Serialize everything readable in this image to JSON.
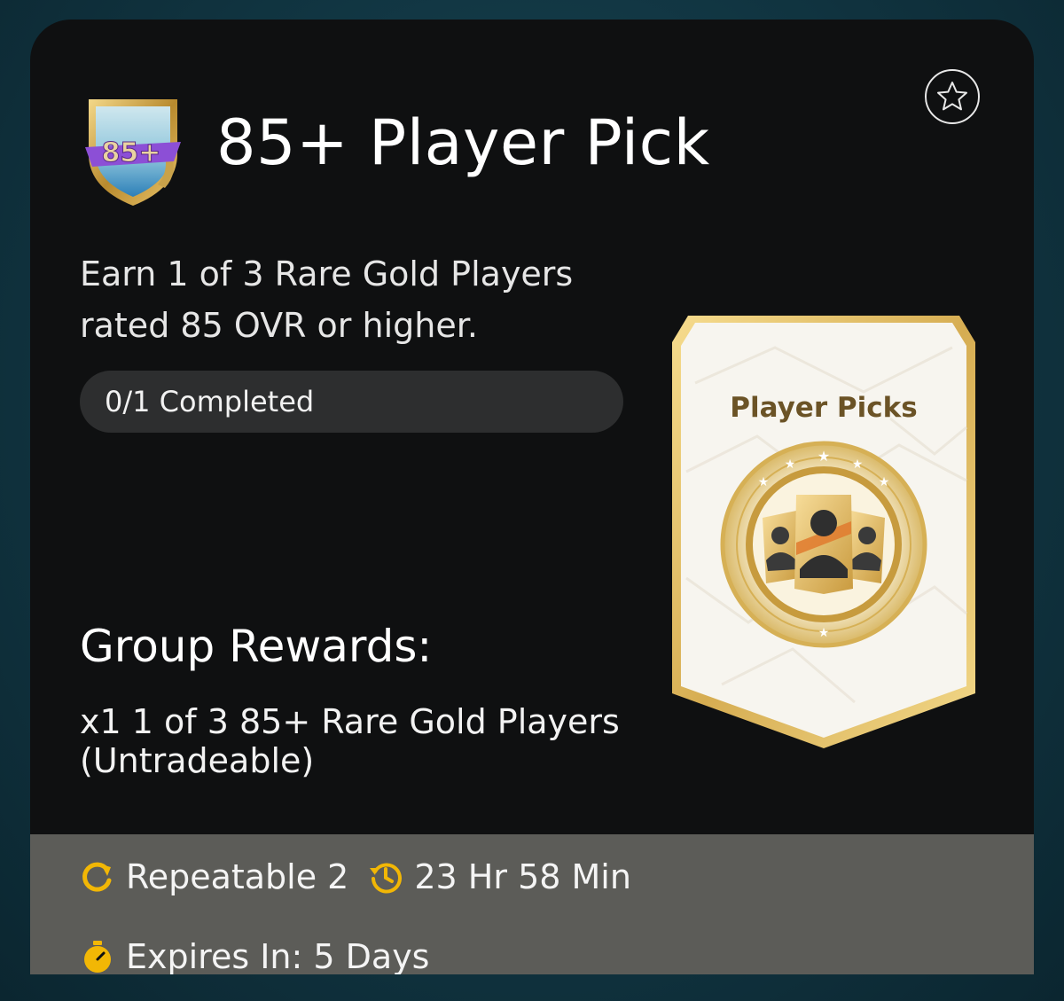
{
  "objective": {
    "title": "85+ Player Pick",
    "badge_text": "85+",
    "description": "Earn 1 of 3 Rare Gold Players rated 85 OVR or higher.",
    "progress": "0/1 Completed",
    "progress_fraction": 0
  },
  "rewards": {
    "heading": "Group Rewards:",
    "text": "x1 1 of 3 85+ Rare Gold Players (Untradeable)",
    "card_label": "Player Picks"
  },
  "footer": {
    "repeatable": "Repeatable 2",
    "timer": "23 Hr 58 Min",
    "expires": "Expires In: 5 Days"
  },
  "icons": {
    "favorite": "star-outline-icon",
    "repeat": "repeat-icon",
    "timer": "history-clock-icon",
    "expires": "stopwatch-icon"
  },
  "colors": {
    "accent": "#f2b705",
    "panel": "#0f1011",
    "footer": "#5c5c58",
    "gold": "#d8b45a"
  }
}
